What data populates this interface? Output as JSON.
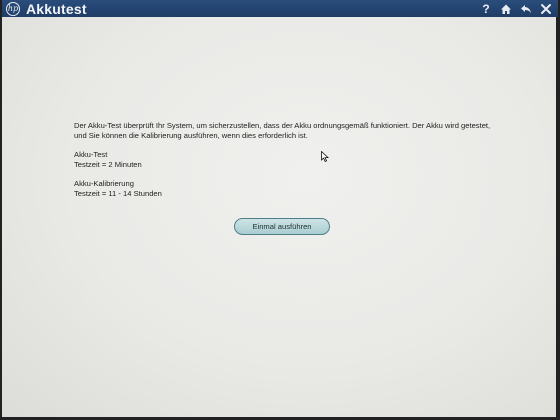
{
  "window": {
    "title": "Akkutest",
    "logo_text": "hp",
    "help_label": "?",
    "icons": [
      "hp-logo-icon",
      "help-icon",
      "home-icon",
      "back-icon",
      "close-icon"
    ],
    "titlebar_color": "#24466f"
  },
  "main": {
    "description": "Der Akku-Test überprüft Ihr System, um sicherzustellen, dass der Akku ordnungsgemäß funktioniert. Der Akku wird getestet, und Sie können die Kalibrierung ausführen, wenn dies erforderlich ist.",
    "sections": [
      {
        "heading": "Akku-Test",
        "detail": "Testzeit = 2 Minuten"
      },
      {
        "heading": "Akku-Kalibrierung",
        "detail": "Testzeit = 11 - 14 Stunden"
      }
    ],
    "run_button_label": "Einmal ausführen",
    "button_color": "#bcd9dc"
  }
}
